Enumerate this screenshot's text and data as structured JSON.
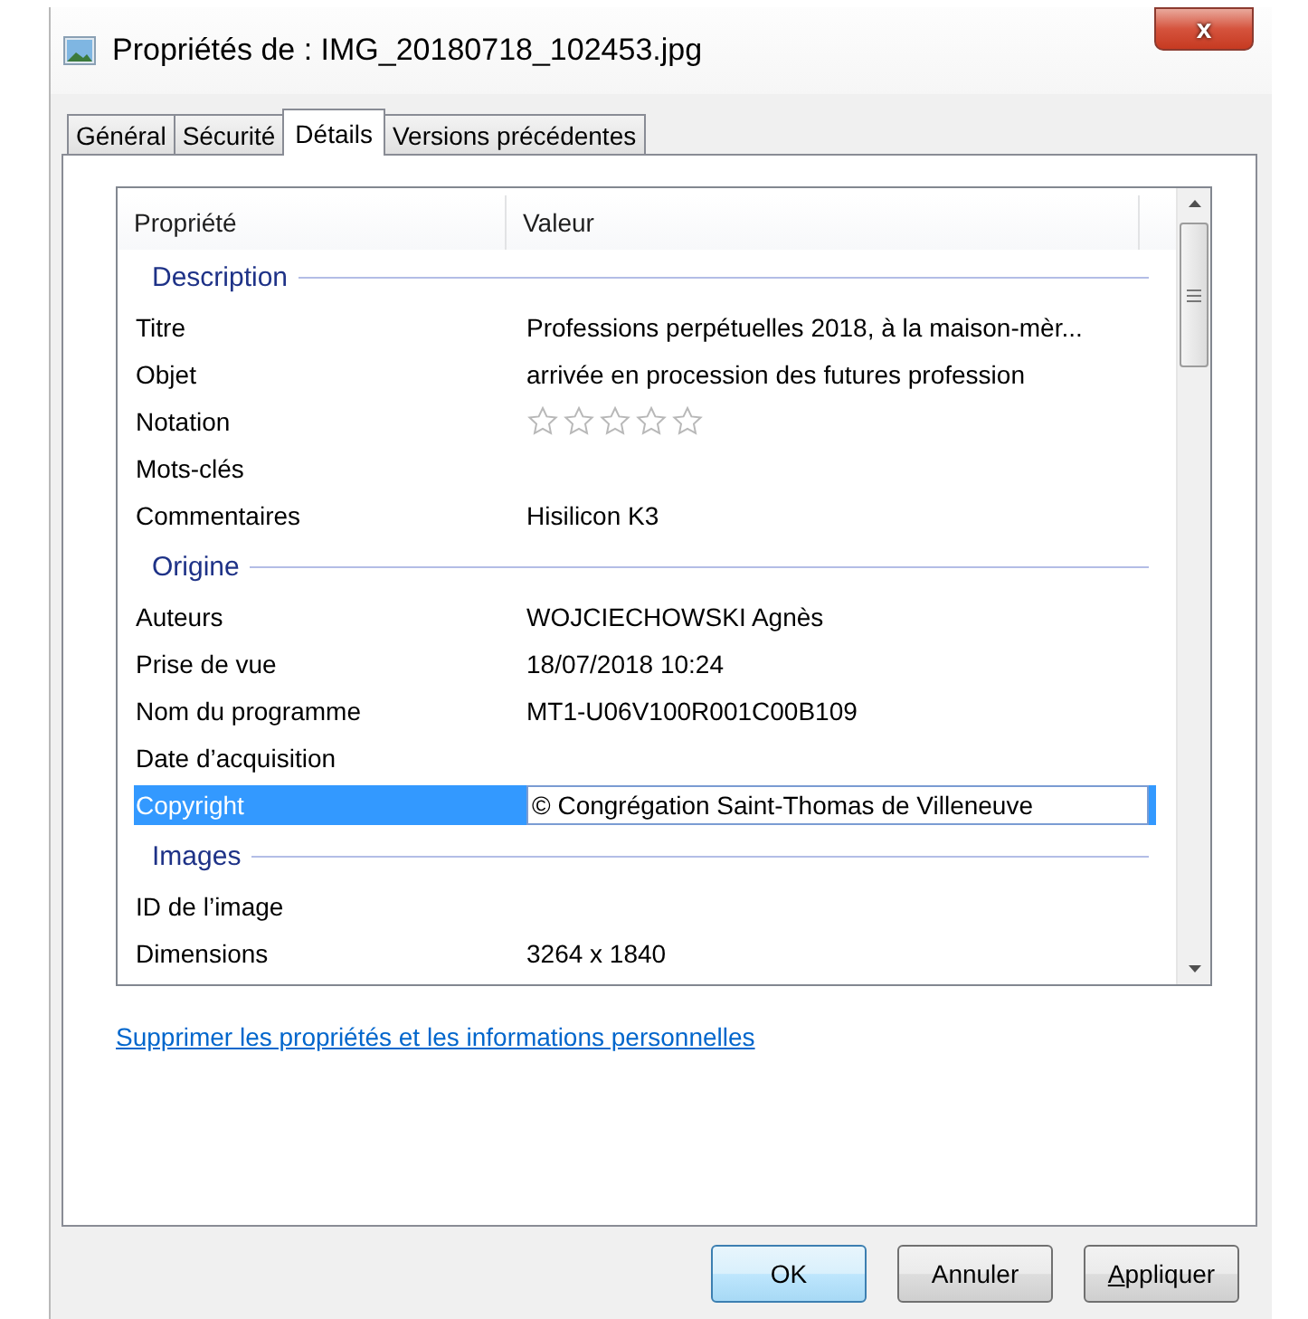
{
  "window": {
    "title": "Propriétés de : IMG_20180718_102453.jpg",
    "close": "x"
  },
  "tabs": [
    {
      "label": "Général",
      "selected": false
    },
    {
      "label": "Sécurité",
      "selected": false
    },
    {
      "label": "Détails",
      "selected": true
    },
    {
      "label": "Versions précédentes",
      "selected": false
    }
  ],
  "table": {
    "columns": [
      "Propriété",
      "Valeur"
    ],
    "groups": [
      {
        "heading": "Description",
        "rows": [
          {
            "kind": "text",
            "name": "Titre",
            "value": "Professions perpétuelles 2018, à la maison-mèr...",
            "selected": false
          },
          {
            "kind": "text",
            "name": "Objet",
            "value": "arrivée en procession des futures profession",
            "selected": false
          },
          {
            "kind": "stars",
            "name": "Notation",
            "stars": 0,
            "selected": false
          },
          {
            "kind": "text",
            "name": "Mots-clés",
            "selected": false
          },
          {
            "kind": "text",
            "name": "Commentaires",
            "value": "Hisilicon K3",
            "selected": false
          }
        ]
      },
      {
        "heading": "Origine",
        "rows": [
          {
            "kind": "text",
            "name": "Auteurs",
            "value": "WOJCIECHOWSKI Agnès",
            "selected": false
          },
          {
            "kind": "text",
            "name": "Prise de vue",
            "value": "18/07/2018 10:24",
            "selected": false
          },
          {
            "kind": "text",
            "name": "Nom du programme",
            "value": "MT1-U06V100R001C00B109",
            "selected": false
          },
          {
            "kind": "text",
            "name": "Date d’acquisition",
            "selected": false
          },
          {
            "kind": "input",
            "name": "Copyright",
            "value": "© Congrégation Saint-Thomas de Villeneuve",
            "selected": true
          }
        ]
      },
      {
        "heading": "Images",
        "rows": [
          {
            "kind": "text",
            "name": "ID de l’image",
            "selected": false
          },
          {
            "kind": "text",
            "name": "Dimensions",
            "value": "3264 x 1840",
            "selected": false
          }
        ]
      }
    ]
  },
  "link": "Supprimer les propriétés et les informations personnelles",
  "buttons": [
    {
      "label": "OK",
      "default": true
    },
    {
      "label": "Annuler",
      "default": false
    },
    {
      "label": "Appliquer",
      "default": false
    }
  ]
}
